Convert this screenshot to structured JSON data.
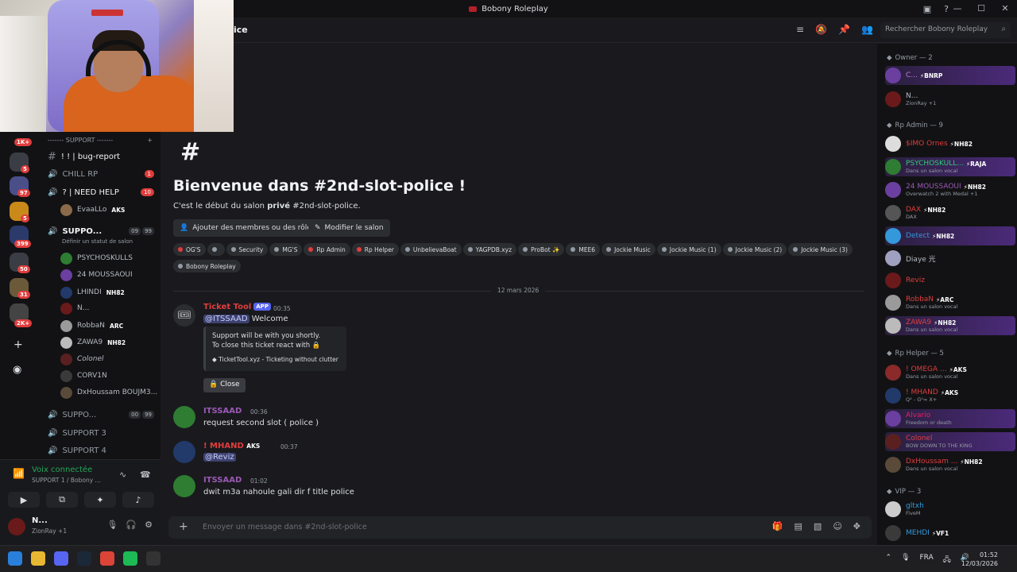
{
  "window": {
    "title": "Bobony Roleplay",
    "controls": [
      "—",
      "☐",
      "✕"
    ]
  },
  "header": {
    "channel": "ice",
    "search_placeholder": "Rechercher Bobony Roleplay"
  },
  "servers": {
    "badges": [
      "1K+",
      "5",
      "97",
      "5",
      "399",
      "50",
      "31",
      "2K+"
    ]
  },
  "channels": {
    "category": "------- SUPPORT -------",
    "items": [
      {
        "name": "!  !  | bug-report",
        "icon": "#"
      },
      {
        "name": "CHILL RP",
        "count": "1"
      },
      {
        "name": "?  | NEED HELP",
        "count": "10"
      },
      {
        "name": "SUPPO...",
        "counts": [
          "09",
          "99"
        ],
        "status": "Définir un statut de salon"
      },
      {
        "name": "SUPPO...",
        "counts": [
          "00",
          "99"
        ]
      },
      {
        "name": "SUPPORT 3"
      },
      {
        "name": "SUPPORT 4"
      }
    ],
    "vc_members": [
      {
        "name": "EvaaLLo",
        "tag": "AKS"
      },
      {
        "name": "PSYCHOSKULLS",
        "tag": ""
      },
      {
        "name": "24 MOUSSAOUI",
        "tag": ""
      },
      {
        "name": "LHINDI",
        "tag": "NH82"
      },
      {
        "name": "N...",
        "tag": ""
      },
      {
        "name": "RobbaN",
        "tag": "ARC"
      },
      {
        "name": "ZAWA9",
        "tag": "NH82"
      },
      {
        "name": "Colonel",
        "tag": ""
      },
      {
        "name": "CORV1N",
        "tag": ""
      },
      {
        "name": "DxHoussam BOUJM3...",
        "tag": ""
      }
    ]
  },
  "voice": {
    "status": "Voix connectée",
    "channel": "SUPPORT 1 / Bobony ..."
  },
  "user": {
    "name": "N...",
    "status": "ZionRay +1"
  },
  "welcome": {
    "title": "Bienvenue dans #2nd-slot-police !",
    "sub_before": "C'est le début du salon ",
    "sub_bold": "privé",
    "sub_after": " #2nd-slot-police.",
    "btn_add": "Ajouter des membres ou des rôles",
    "btn_edit": "Modifier le salon",
    "chips": [
      {
        "label": "OG'S",
        "color": "#e03d3d"
      },
      {
        "label": "",
        "color": "#949ba4"
      },
      {
        "label": "Security",
        "color": "#949ba4"
      },
      {
        "label": "MG'S",
        "color": "#949ba4"
      },
      {
        "label": "Rp Admin",
        "color": "#e03d3d"
      },
      {
        "label": "Rp Helper",
        "color": "#e03d3d"
      },
      {
        "label": "UnbelievaBoat",
        "color": "#949ba4"
      },
      {
        "label": "YAGPDB.xyz",
        "color": "#949ba4"
      },
      {
        "label": "ProBot ✨",
        "color": "#949ba4"
      },
      {
        "label": "MEE6",
        "color": "#949ba4"
      },
      {
        "label": "Jockie Music",
        "color": "#949ba4"
      },
      {
        "label": "Jockie Music (1)",
        "color": "#949ba4"
      },
      {
        "label": "Jockie Music (2)",
        "color": "#949ba4"
      },
      {
        "label": "Jockie Music (3)",
        "color": "#949ba4"
      },
      {
        "label": "Bobony Roleplay",
        "color": "#949ba4"
      }
    ]
  },
  "date_divider": "12 mars 2026",
  "messages": [
    {
      "user": "Ticket Tool",
      "app": "APP",
      "time": "00:35",
      "mention": "@ITSSAAD",
      "text": " Welcome",
      "embed": {
        "line1": "Support will be with you shortly.",
        "line2": "To close this ticket react with 🔒",
        "footer": "TicketTool.xyz - Ticketing without clutter"
      },
      "button": "Close"
    },
    {
      "user": "ITSSAAD",
      "time": "00:36",
      "text": "request second slot ( police )"
    },
    {
      "user": "! MHAND",
      "tag": "AKS",
      "time": "00:37",
      "mention": "@Reviz",
      "text": ""
    },
    {
      "user": "ITSSAAD",
      "time": "01:02",
      "text": "dwit m3a nahoule gali dir f title police"
    }
  ],
  "composer": {
    "placeholder": "Envoyer un message dans #2nd-slot-police"
  },
  "members": {
    "sections": [
      {
        "title": "Owner — 2"
      },
      {
        "title": "Rp Admin — 9"
      },
      {
        "title": "Rp Helper — 5"
      },
      {
        "title": "VIP — 3"
      }
    ],
    "list": [
      {
        "name": "C...",
        "tag": "BNRP",
        "status": ""
      },
      {
        "name": "N...",
        "tag": "",
        "status": "ZionRay +1"
      },
      {
        "name": "$IMO Ornes",
        "tag": "NH82",
        "status": ""
      },
      {
        "name": "PSYCHOSKULL...",
        "tag": "RAJA",
        "status": "Dans un salon vocal"
      },
      {
        "name": "24 MOUSSAOUI",
        "tag": "NH82",
        "status": "Overwatch 2 with Medal +1"
      },
      {
        "name": "DAX",
        "tag": "NH82",
        "status": "DAX"
      },
      {
        "name": "Detect",
        "tag": "NH82",
        "status": ""
      },
      {
        "name": "Diaye 光",
        "tag": "",
        "status": ""
      },
      {
        "name": "Reviz",
        "tag": "",
        "status": ""
      },
      {
        "name": "RobbaN",
        "tag": "ARC",
        "status": "Dans un salon vocal"
      },
      {
        "name": "ZAWA9",
        "tag": "NH82",
        "status": "Dans un salon vocal"
      },
      {
        "name": "! OMEGA ...",
        "tag": "AKS",
        "status": "Dans un salon vocal"
      },
      {
        "name": "! MHAND",
        "tag": "AKS",
        "status": "Q⁴ - G⁰∞ X+"
      },
      {
        "name": "Alvario",
        "tag": "",
        "status": "Freedom or death"
      },
      {
        "name": "Colonel",
        "tag": "",
        "status": "BOW DOWN TO THE KING"
      },
      {
        "name": "DxHoussam ...",
        "tag": "NH82",
        "status": "Dans un salon vocal"
      },
      {
        "name": "gltxh",
        "tag": "",
        "status": "FiveM"
      },
      {
        "name": "MEHDI",
        "tag": "VF1",
        "status": ""
      }
    ]
  },
  "taskbar": {
    "lang": "FRA",
    "time": "01:52",
    "date": "12/03/2026"
  },
  "colors": {
    "accent": "#5865f2",
    "online": "#23a55a",
    "danger": "#e03d3d"
  }
}
